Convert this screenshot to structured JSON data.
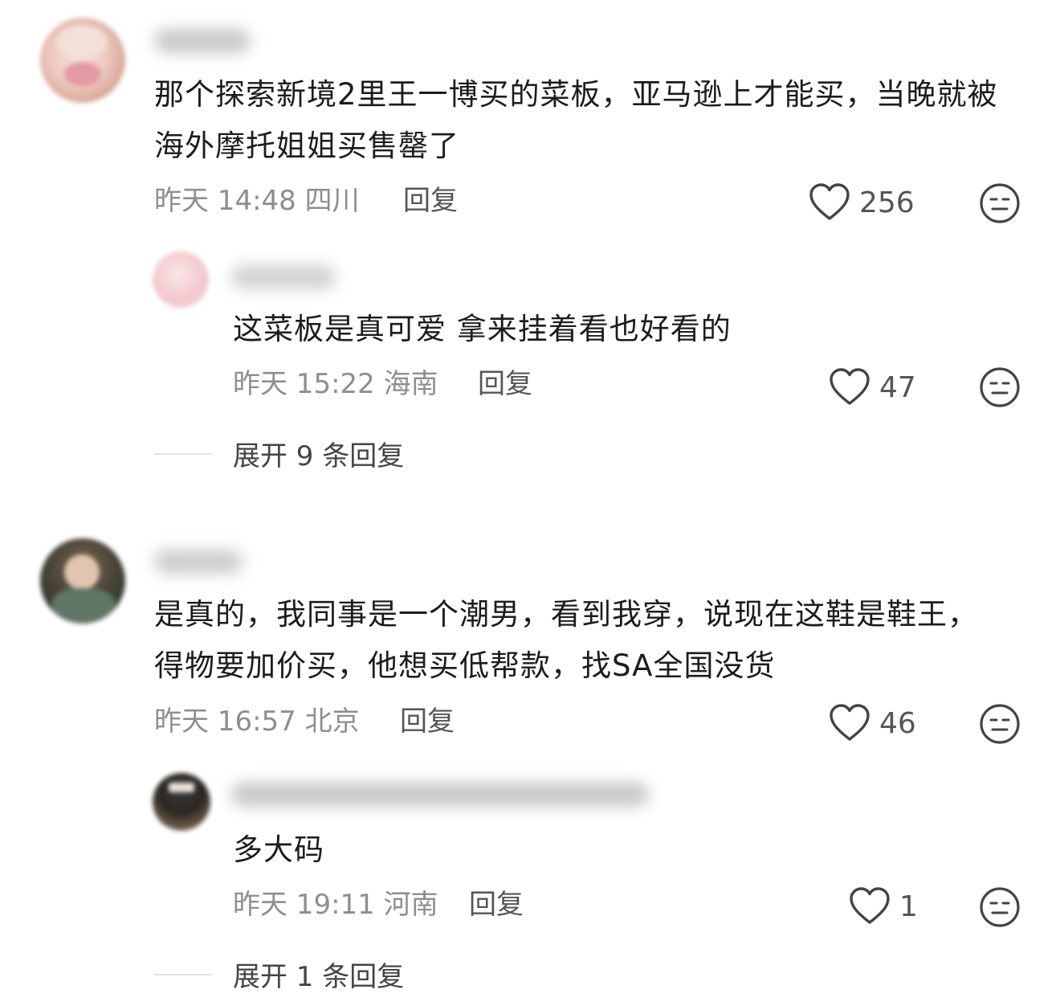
{
  "comments": [
    {
      "text": "那个探索新境2里王一博买的菜板，亚马逊上才能买，当晚就被海外摩托姐姐买售罄了",
      "time": "昨天 14:48 四川",
      "reply_label": "回复",
      "likes": "256",
      "replies": [
        {
          "text": "这菜板是真可爱 拿来挂着看也好看的",
          "time": "昨天 15:22 海南",
          "reply_label": "回复",
          "likes": "47"
        }
      ],
      "expand_label": "展开 9 条回复"
    },
    {
      "text": "是真的，我同事是一个潮男，看到我穿，说现在这鞋是鞋王，得物要加价买，他想买低帮款，找SA全国没货",
      "time": "昨天 16:57 北京",
      "reply_label": "回复",
      "likes": "46",
      "replies": [
        {
          "text": "多大码",
          "time": "昨天 19:11 河南",
          "reply_label": "回复",
          "likes": "1"
        }
      ],
      "expand_label": "展开 1 条回复"
    }
  ],
  "icons": {
    "like": "heart-outline-icon",
    "dislike": "neutral-face-icon"
  },
  "colors": {
    "meta_text": "#8e8e8e",
    "body_text": "#1c1c1c",
    "icon_stroke": "#444444"
  }
}
